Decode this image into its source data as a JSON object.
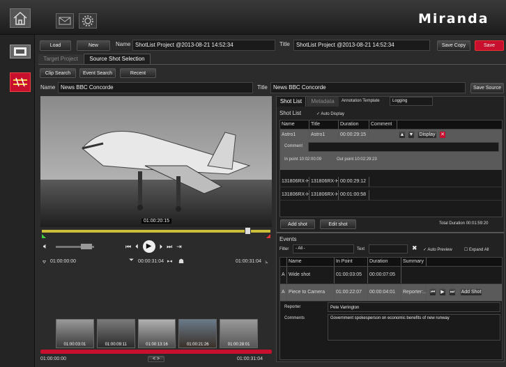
{
  "topbar": {
    "home_icon": "home-icon",
    "mail_icon": "mail-icon",
    "gear_icon": "gear-icon",
    "brand": "Miranda"
  },
  "project": {
    "load": "Load",
    "new": "New",
    "name_label": "Name",
    "name_value": "ShotList Project @2013-08-21 14:52:34",
    "title_label": "Title",
    "title_value": "ShotList Project @2013-08-21 14:52:34",
    "save_copy": "Save Copy",
    "save": "Save"
  },
  "tabs": {
    "target": "Target Project",
    "source": "Source Shot Selection"
  },
  "search": {
    "clip": "Clip Search",
    "event": "Event Search",
    "recent": "Recent"
  },
  "source": {
    "name_label": "Name",
    "name_value": "News BBC Concorde",
    "title_label": "Title",
    "title_value": "News BBC Concorde",
    "save_source": "Save Source"
  },
  "player": {
    "overlay_tc": "01:00:20:15",
    "tc_in": "01:00:00:00",
    "tc_current": "00:00:31:04",
    "tc_out": "01:00:31:04",
    "bottom_start": "01:00:00:00",
    "bottom_end": "01:00:31:04",
    "playhead": 0.88
  },
  "thumbnails": [
    {
      "tc": "01:00:03:01"
    },
    {
      "tc": "01:00:09:11"
    },
    {
      "tc": "01:00:13:16"
    },
    {
      "tc": "01:00:21:26"
    },
    {
      "tc": "01:00:28:01"
    }
  ],
  "right_tabs": {
    "shot_list": "Shot List",
    "metadata": "Metadata",
    "annotation": "Annotation Template",
    "template_value": "Logging"
  },
  "shot_list": {
    "heading": "Shot List",
    "auto_display": "Auto Display",
    "columns": [
      "Name",
      "Title",
      "Duration",
      "Comment"
    ],
    "selected": {
      "name": "Astro1",
      "title": "Astro1",
      "duration": "00:00:29:15",
      "display": "Display",
      "comment_label": "Comment",
      "in_point": "In point  10:02:00:09",
      "out_point": "Out point  10:02:29:23"
    },
    "rows": [
      {
        "name": "131806RX-H",
        "title": "131806RX-H",
        "duration": "00:00:29:12"
      },
      {
        "name": "131806RX-H",
        "title": "131806RX-H",
        "duration": "00:01:00:58"
      }
    ],
    "add_shot": "Add shot",
    "edit_shot": "Edit shot",
    "total_label": "Total Duration",
    "total_value": "00:01:59:20"
  },
  "events": {
    "heading": "Events",
    "filter_label": "Filter",
    "filter_value": "- All -",
    "text_label": "Text",
    "auto_preview": "Auto Preview",
    "expand_all": "Expand All",
    "columns": [
      "Name",
      "In Point",
      "Duration",
      "Summary"
    ],
    "rows": [
      {
        "type": "A",
        "name": "Wide shot",
        "in": "01:00:03:05",
        "dur": "00:00:07:05",
        "summary": ""
      },
      {
        "type": "A",
        "name": "Piece to Camera",
        "in": "01:00:22:07",
        "dur": "00:00:04:01",
        "summary": "Reporter:..."
      }
    ],
    "add_shot": "Add Shot",
    "detail": {
      "reporter_label": "Reporter",
      "reporter_value": "Pete Varrington",
      "comments_label": "Comments",
      "comments_value": "Government spokesperson on economic benefits of new runway"
    }
  },
  "colors": {
    "accent_red": "#c8102e",
    "progress_yellow": "#cbbf3a",
    "bg": "#2b2b2b"
  }
}
